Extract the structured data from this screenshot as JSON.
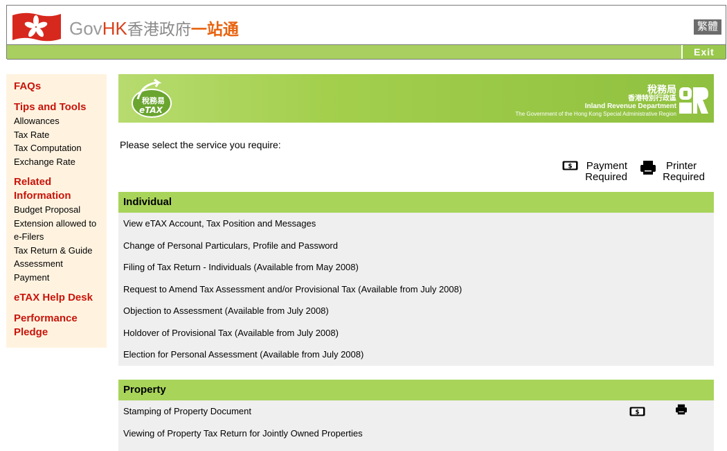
{
  "header": {
    "brand_gov": "Gov",
    "brand_hk": "HK",
    "brand_cn1": "香港政府",
    "brand_cn2": "一站通",
    "lang_button": "繁體",
    "exit_button": "Exit"
  },
  "sidebar": {
    "faqs": "FAQs",
    "tips_heading": "Tips and Tools",
    "tips_items": [
      "Allowances",
      "Tax Rate",
      "Tax Computation",
      "Exchange Rate"
    ],
    "related_heading_1": "Related",
    "related_heading_2": "Information",
    "related_items": [
      "Budget Proposal",
      "Extension allowed to",
      "e-Filers",
      "Tax Return & Guide",
      "Assessment",
      "Payment"
    ],
    "helpdesk": "eTAX Help Desk",
    "pledge_1": "Performance",
    "pledge_2": "Pledge"
  },
  "banner": {
    "logo_cn": "稅務易",
    "logo_en": "eTAX",
    "dept_cn": "稅務局",
    "region_cn": "香港特別行政區",
    "dept_en": "Inland Revenue Department",
    "gov_en": "The Government of the Hong Kong Special Administrative Region"
  },
  "main": {
    "prompt": "Please select the service you require:",
    "legend_payment_1": "Payment",
    "legend_payment_2": "Required",
    "legend_printer_1": "Printer",
    "legend_printer_2": "Required"
  },
  "sections": {
    "individual": {
      "title": "Individual",
      "items": [
        "View eTAX Account, Tax Position and Messages",
        "Change of Personal Particulars, Profile and Password",
        "Filing of Tax Return - Individuals (Available from May 2008)",
        "Request to Amend Tax Assessment and/or Provisional Tax (Available from July 2008)",
        "Objection to Assessment (Available from July 2008)",
        "Holdover of Provisional Tax (Available from July 2008)",
        "Election for Personal Assessment (Available from July 2008)"
      ]
    },
    "property": {
      "title": "Property",
      "items": [
        "Stamping of Property Document",
        "Viewing of Property Tax Return for Jointly Owned Properties"
      ]
    }
  },
  "colors": {
    "green_bar": "#a8cf5f",
    "section_header": "#a8d45a",
    "sidebar_bg": "#fff3e0",
    "sidebar_heading": "#c8140a"
  },
  "icons": {
    "payment": "dollar-sign-icon",
    "printer": "printer-icon"
  }
}
